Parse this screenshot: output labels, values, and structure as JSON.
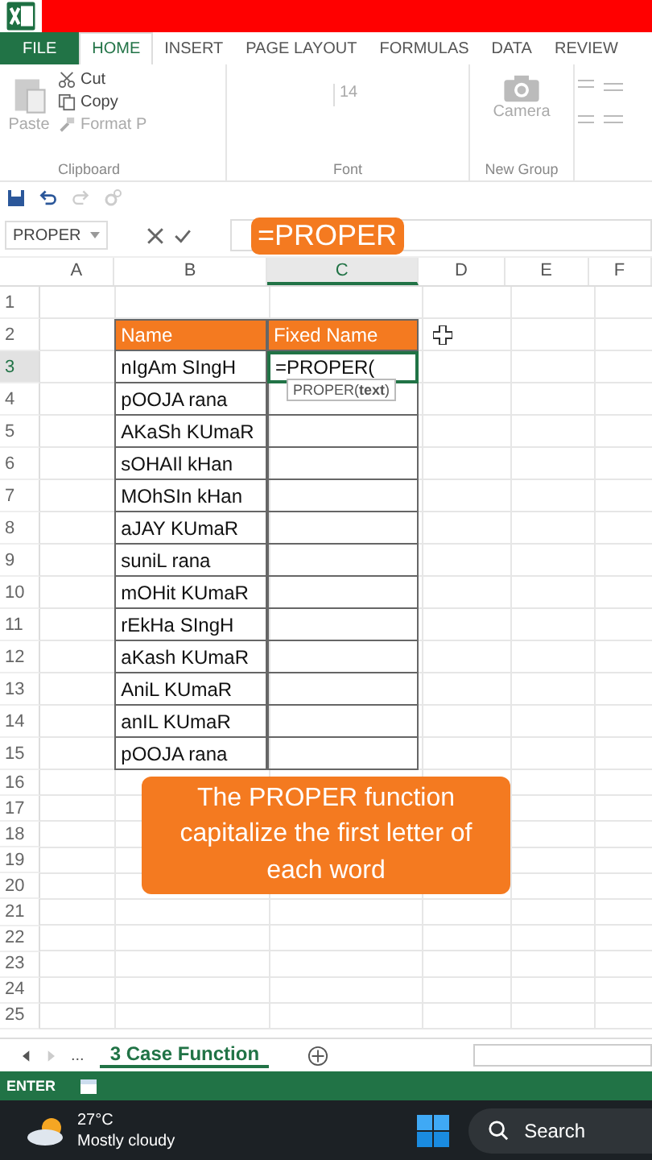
{
  "ribbon_tabs": [
    {
      "label": "FILE",
      "selected": false
    },
    {
      "label": "HOME",
      "selected": true
    },
    {
      "label": "INSERT",
      "selected": false
    },
    {
      "label": "PAGE LAYOUT",
      "selected": false
    },
    {
      "label": "FORMULAS",
      "selected": false
    },
    {
      "label": "DATA",
      "selected": false
    },
    {
      "label": "REVIEW",
      "selected": false
    }
  ],
  "clipboard": {
    "paste": "Paste",
    "cut": "Cut",
    "copy": "Copy",
    "format_painter": "Format P",
    "group": "Clipboard"
  },
  "font": {
    "size": "14",
    "group": "Font"
  },
  "new_group": {
    "camera": "Camera",
    "group": "New Group"
  },
  "name_box": "PROPER",
  "formula_label": "=PROPER",
  "columns": [
    {
      "label": "A",
      "selected": false
    },
    {
      "label": "B",
      "selected": false
    },
    {
      "label": "C",
      "selected": true
    },
    {
      "label": "D",
      "selected": false
    },
    {
      "label": "E",
      "selected": false
    },
    {
      "label": "F",
      "selected": false
    }
  ],
  "row_numbers": [
    {
      "label": "1",
      "selected": false
    },
    {
      "label": "2",
      "selected": false
    },
    {
      "label": "3",
      "selected": true
    },
    {
      "label": "4",
      "selected": false
    },
    {
      "label": "5",
      "selected": false
    },
    {
      "label": "6",
      "selected": false
    },
    {
      "label": "7",
      "selected": false
    },
    {
      "label": "8",
      "selected": false
    },
    {
      "label": "9",
      "selected": false
    },
    {
      "label": "10",
      "selected": false
    },
    {
      "label": "11",
      "selected": false
    },
    {
      "label": "12",
      "selected": false
    },
    {
      "label": "13",
      "selected": false
    },
    {
      "label": "14",
      "selected": false
    },
    {
      "label": "15",
      "selected": false
    },
    {
      "label": "16",
      "selected": false
    },
    {
      "label": "17",
      "selected": false
    },
    {
      "label": "18",
      "selected": false
    },
    {
      "label": "19",
      "selected": false
    },
    {
      "label": "20",
      "selected": false
    },
    {
      "label": "21",
      "selected": false
    },
    {
      "label": "22",
      "selected": false
    },
    {
      "label": "23",
      "selected": false
    },
    {
      "label": "24",
      "selected": false
    },
    {
      "label": "25",
      "selected": false
    }
  ],
  "table": {
    "headers": [
      "Name",
      "Fixed Name"
    ],
    "names": [
      "nIgAm SIngH",
      "pOOJA rana",
      "AKaSh KUmaR",
      "sOHAIl kHan",
      "MOhSIn kHan",
      "aJAY KUmaR",
      "suniL rana",
      "mOHit KUmaR",
      "rEkHa SIngH",
      "aKash KUmaR",
      "AniL KUmaR",
      "anIL KUmaR",
      "pOOJA rana"
    ]
  },
  "active_cell": {
    "value": "=PROPER(",
    "tooltip": "PROPER(**text**)"
  },
  "callout": "The PROPER function capitalize the first letter of each word",
  "sheet_tab": "3 Case Function",
  "sheet_nav": "...",
  "status": "ENTER",
  "taskbar": {
    "temperature": "27°C",
    "weather": "Mostly cloudy",
    "search": "Search"
  }
}
